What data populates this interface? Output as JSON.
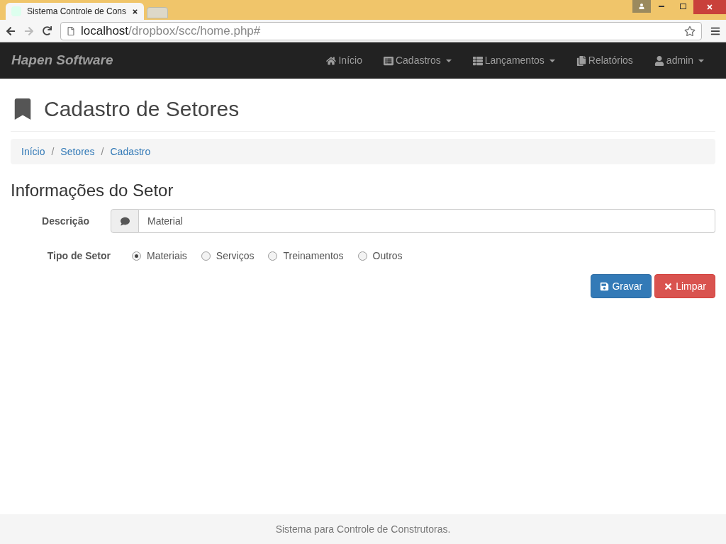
{
  "browser": {
    "tab_title": "Sistema Controle de Cons",
    "url_host": "localhost",
    "url_path": "/dropbox/scc/home.php#"
  },
  "navbar": {
    "brand": "Hapen Software",
    "items": [
      {
        "label": "Início",
        "dropdown": false
      },
      {
        "label": "Cadastros",
        "dropdown": true
      },
      {
        "label": "Lançamentos",
        "dropdown": true
      },
      {
        "label": "Relatórios",
        "dropdown": false
      },
      {
        "label": "admin",
        "dropdown": true
      }
    ]
  },
  "page_title": "Cadastro de Setores",
  "breadcrumb": [
    "Início",
    "Setores",
    "Cadastro"
  ],
  "breadcrumb_separators": [
    "/",
    "/"
  ],
  "section_title": "Informações do Setor",
  "form": {
    "description_label": "Descrição",
    "description_value": "Material",
    "type_label": "Tipo de Setor",
    "options": [
      {
        "label": "Materiais",
        "selected": true
      },
      {
        "label": "Serviços",
        "selected": false
      },
      {
        "label": "Treinamentos",
        "selected": false
      },
      {
        "label": "Outros",
        "selected": false
      }
    ]
  },
  "buttons": [
    {
      "label": "Gravar",
      "kind": "save"
    },
    {
      "label": "Limpar",
      "kind": "clear"
    }
  ],
  "footer": "Sistema para Controle de Construtoras."
}
